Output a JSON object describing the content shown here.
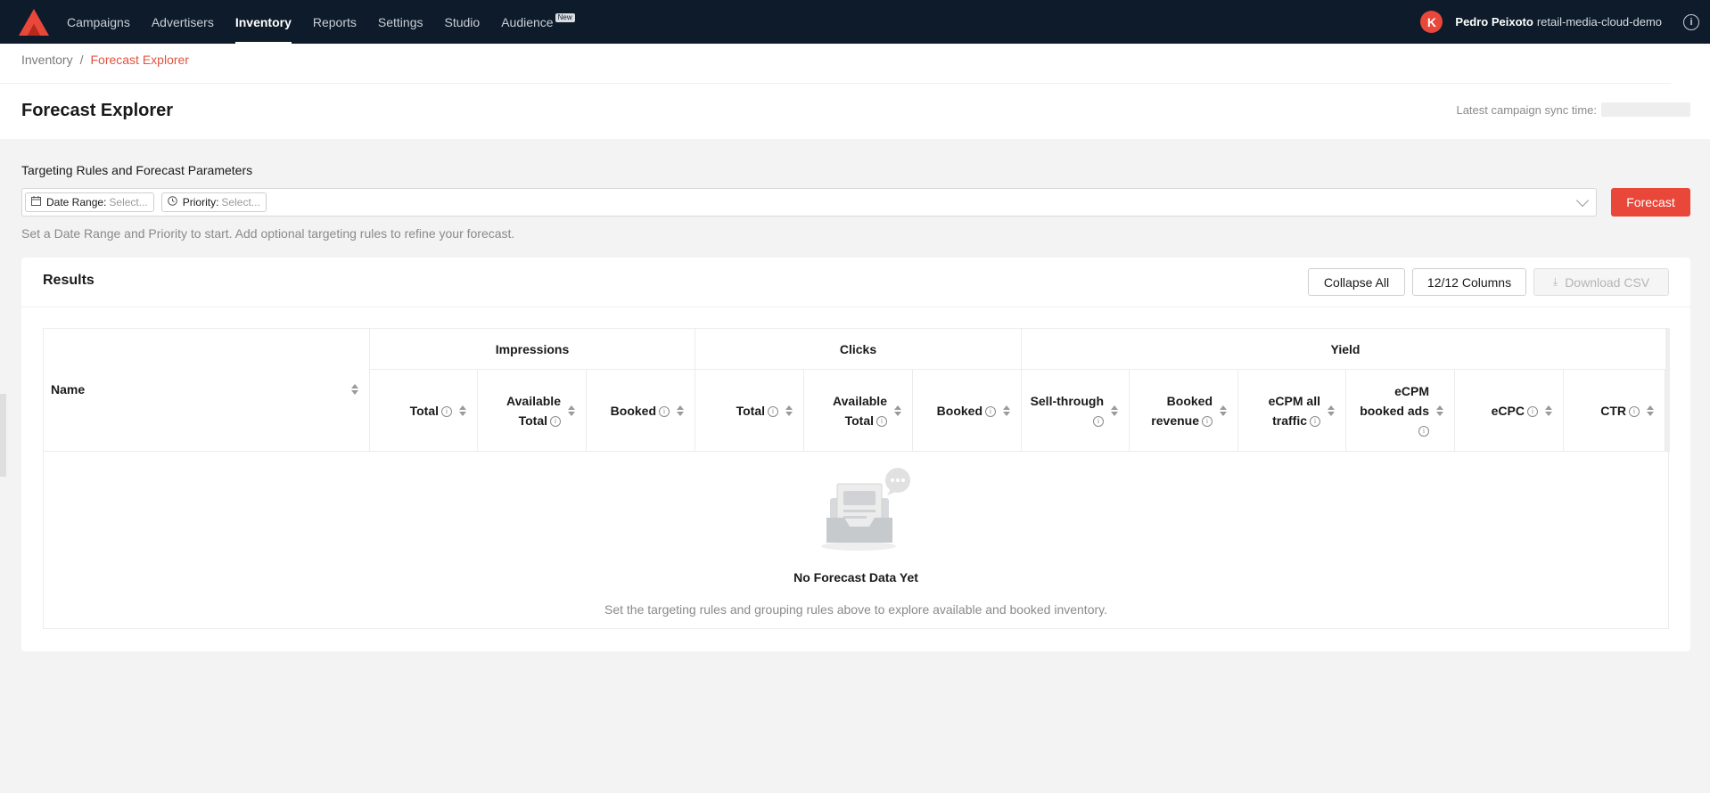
{
  "nav": {
    "logo": "brand-logo",
    "items": [
      {
        "label": "Campaigns"
      },
      {
        "label": "Advertisers"
      },
      {
        "label": "Inventory"
      },
      {
        "label": "Reports"
      },
      {
        "label": "Settings"
      },
      {
        "label": "Studio"
      },
      {
        "label": "Audience",
        "badge": "New"
      }
    ],
    "active_item": "Inventory",
    "avatar_letter": "K",
    "user_name": "Pedro Peixoto",
    "org": "retail-media-cloud-demo",
    "colors": {
      "background": "#0d1b2a",
      "accent": "#e9473a"
    }
  },
  "breadcrumb": {
    "parent": "Inventory",
    "separator": "/",
    "current": "Forecast Explorer"
  },
  "page": {
    "title": "Forecast Explorer",
    "sync_label": "Latest campaign sync time:"
  },
  "targeting": {
    "label": "Targeting Rules and Forecast Parameters",
    "chips": [
      {
        "label": "Date Range:",
        "placeholder": "Select...",
        "icon": "calendar-icon"
      },
      {
        "label": "Priority:",
        "placeholder": "Select...",
        "icon": "clock-icon"
      }
    ],
    "forecast_button": "Forecast",
    "hint": "Set a Date Range and Priority to start. Add optional targeting rules to refine your forecast."
  },
  "results": {
    "title": "Results",
    "collapse_all": "Collapse All",
    "columns_button": "12/12 Columns",
    "download_csv": "Download CSV",
    "name_header": "Name",
    "groups": [
      {
        "label": "Impressions"
      },
      {
        "label": "Clicks"
      },
      {
        "label": "Yield"
      }
    ],
    "columns": [
      {
        "line1": "Total",
        "line2": ""
      },
      {
        "line1": "Available",
        "line2": "Total"
      },
      {
        "line1": "Booked",
        "line2": ""
      },
      {
        "line1": "Total",
        "line2": ""
      },
      {
        "line1": "Available",
        "line2": "Total"
      },
      {
        "line1": "Booked",
        "line2": ""
      },
      {
        "line1": "Sell-through",
        "line2": ""
      },
      {
        "line1": "Booked",
        "line2": "revenue"
      },
      {
        "line1": "eCPM all",
        "line2": "traffic"
      },
      {
        "line1": "eCPM",
        "line2": "booked ads"
      },
      {
        "line1": "eCPC",
        "line2": ""
      },
      {
        "line1": "CTR",
        "line2": ""
      }
    ],
    "empty_title": "No Forecast Data Yet",
    "empty_subtitle": "Set the targeting rules and grouping rules above to explore available and booked inventory."
  }
}
